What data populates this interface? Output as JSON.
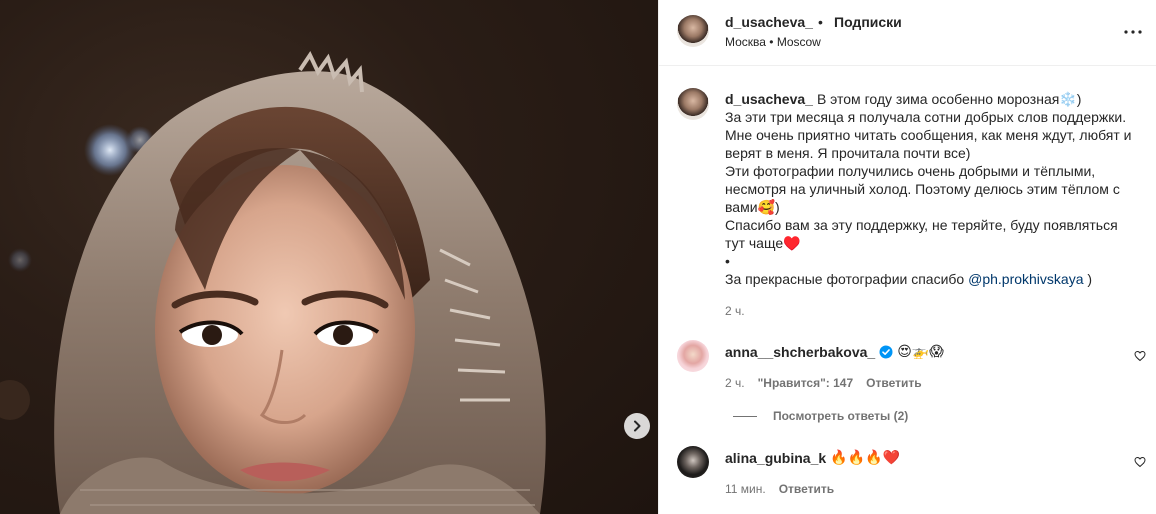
{
  "post": {
    "username": "d_usacheva_",
    "separator": "•",
    "follow_label": "Подписки",
    "location": "Москва • Moscow",
    "more_icon": "more-horizontal-icon"
  },
  "caption": {
    "username": "d_usacheva_",
    "line1": "В этом году зима особенно морозная❄️)",
    "line2": "За эти три месяца я получала сотни добрых слов поддержки.",
    "line3": "Мне очень приятно читать сообщения, как меня ждут, любят и верят в меня. Я прочитала почти все)",
    "line4": "Эти фотографии получились очень добрыми и тёплыми, несмотря на уличный холод. Поэтому делюсь этим тёплом с вами🥰)",
    "line5": "Спасибо вам за эту поддержку, не теряйте, буду появляться тут чаще♥️",
    "line6": "•",
    "line7_prefix": "За прекрасные фотографии спасибо ",
    "mention": "@ph.prokhivskaya",
    "line7_suffix": " )",
    "time": "2 ч."
  },
  "comments": [
    {
      "username": "anna__shcherbakova_",
      "verified": true,
      "text": "😍🚁😱",
      "time": "2 ч.",
      "likes": "\"Нравится\": 147",
      "reply": "Ответить",
      "view_replies": "Посмотреть ответы (2)"
    },
    {
      "username": "alina_gubina_k",
      "verified": false,
      "text": "🔥🔥🔥❤️",
      "time": "11 мин.",
      "reply": "Ответить"
    }
  ],
  "colors": {
    "text": "#262626",
    "secondary": "#737373",
    "link": "#00376b",
    "verified": "#0095f6"
  }
}
